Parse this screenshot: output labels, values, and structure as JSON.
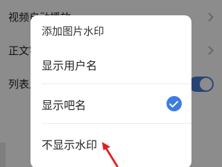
{
  "settings": {
    "rows": [
      {
        "label": "视频自动播放"
      },
      {
        "label": "正文字号"
      },
      {
        "label": "列表显示"
      }
    ]
  },
  "dialog": {
    "title": "添加图片水印",
    "options": [
      {
        "label": "显示用户名",
        "selected": false
      },
      {
        "label": "显示吧名",
        "selected": true
      },
      {
        "label": "不显示水印",
        "selected": false
      }
    ]
  },
  "colors": {
    "accent": "#3e7de0",
    "annotation": "#e02020",
    "overlay": "rgba(0,0,0,0.45)"
  },
  "icons": {
    "chevron": "chevron-right-icon",
    "check": "check-circle-icon",
    "arrow": "annotation-arrow-icon"
  }
}
